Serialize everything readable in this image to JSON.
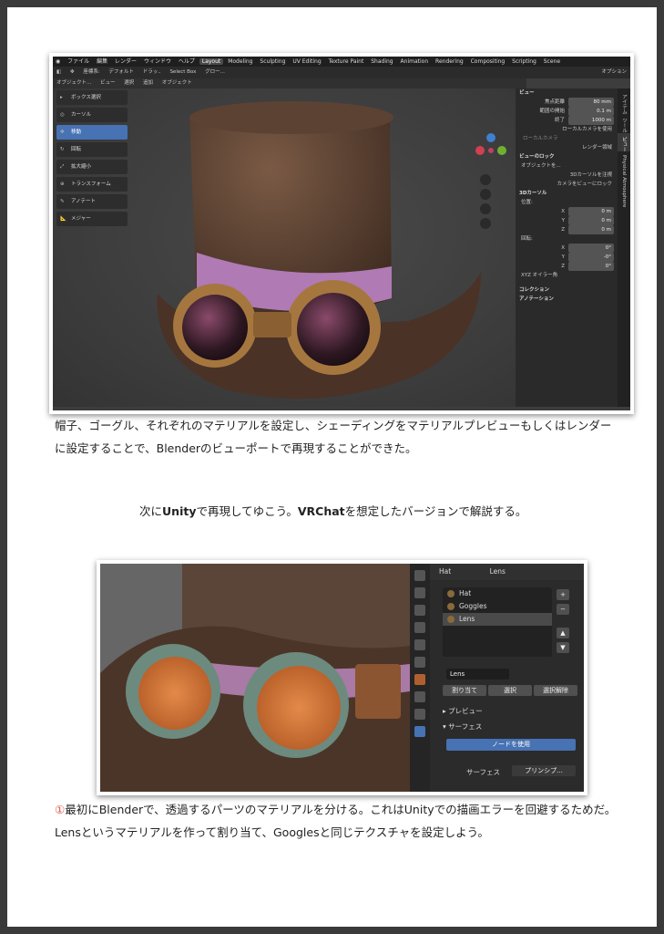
{
  "screenshot1": {
    "topbar": {
      "menus": [
        "ファイル",
        "編集",
        "レンダー",
        "ウィンドウ",
        "ヘルプ"
      ],
      "workspaces": [
        "Layout",
        "Modeling",
        "Sculpting",
        "UV Editing",
        "Texture Paint",
        "Shading",
        "Animation",
        "Rendering",
        "Compositing",
        "Scripting"
      ],
      "scene": "Scene"
    },
    "toolbar": {
      "coord": "座標系:",
      "orientation": "デフォルト",
      "drag": "ドラッ..",
      "select": "Select Box",
      "global": "グロー...",
      "options": "オプション"
    },
    "header": [
      "オブジェクト...",
      "ビュー",
      "選択",
      "追加",
      "オブジェクト"
    ],
    "tools": [
      "ボックス選択",
      "カーソル",
      "移動",
      "回転",
      "拡大縮小",
      "トランスフォーム",
      "アノテート",
      "メジャー"
    ],
    "selected_tool_index": 2,
    "npanel": {
      "view_title": "ビュー",
      "focal_label": "焦点距離",
      "focal_value": "80 mm",
      "clip_start_label": "範囲の開始",
      "clip_start_value": "0.1 m",
      "clip_end_label": "終了",
      "clip_end_value": "1000 m",
      "local_camera": "ローカルカメラを使用",
      "local_camera2": "ローカルカメラ",
      "render_region": "レンダー領域",
      "view_lock_title": "ビューのロック",
      "lock_object": "オブジェクトを...",
      "lock_3d_cursor": "3Dカーソルを注視",
      "lock_camera": "カメラをビューにロック",
      "cursor_title": "3Dカーソル",
      "location_label": "位置:",
      "x_label": "X",
      "x_value": "0 m",
      "y_label": "Y",
      "y_value": "0 m",
      "z_label": "Z",
      "z_value": "0 m",
      "rotation_label": "回転:",
      "rx_value": "0°",
      "ry_value": "-0°",
      "rz_value": "0°",
      "euler": "XYZ オイラー角",
      "collection": "コレクション",
      "annotation": "アノテーション"
    },
    "vtabs": [
      "アイテム",
      "ツール",
      "ビュー",
      "Physical Atmosphere"
    ]
  },
  "paragraph1": "帽子、ゴーグル、それぞれのマテリアルを設定し、シェーディングをマテリアルプレビューもしくはレンダーに設定することで、Blenderのビューポートで再現することができた。",
  "paragraph2": {
    "pre": "次に",
    "bold1": "Unity",
    "mid": "で再現してゆこう。",
    "bold2": "VRChat",
    "post": "を想定したバージョンで解説する。"
  },
  "screenshot2": {
    "object": "Hat",
    "material_header": "Lens",
    "slots": [
      "Hat",
      "Goggles",
      "Lens"
    ],
    "selected_slot": 2,
    "material_name": "Lens",
    "assign": "割り当て",
    "select": "選択",
    "deselect": "選択解除",
    "preview": "プレビュー",
    "surface_section": "サーフェス",
    "use_nodes": "ノードを使用",
    "surface_label": "サーフェス",
    "surface_value": "プリンシプ..."
  },
  "paragraph3": {
    "marker": "①",
    "text": "最初にBlenderで、透過するパーツのマテリアルを分ける。これはUnityでの描画エラーを回避するためだ。Lensというマテリアルを作って割り当て、Googlesと同じテクスチャを設定しよう。"
  },
  "colors": {
    "accent": "#4772b3",
    "marker": "#e0584a"
  }
}
